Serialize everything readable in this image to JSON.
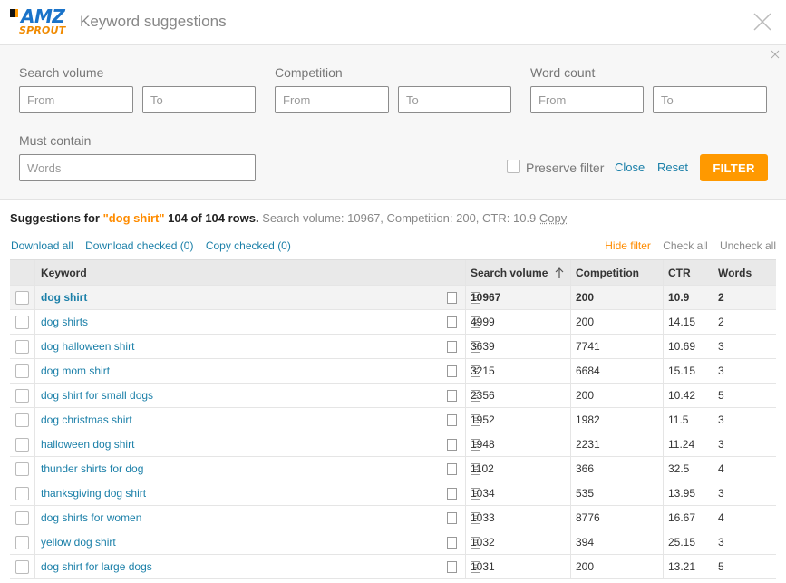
{
  "app": {
    "logo_top": "AMZ",
    "logo_bottom": "SPROUT",
    "title": "Keyword suggestions"
  },
  "icons": {
    "close": "close-icon",
    "copy": "copy-icon",
    "details": "document-icon",
    "sort": "sort-arrow-up-icon"
  },
  "colors": {
    "accent": "#ff9900",
    "link": "#1a7fa8",
    "brand_blue": "#1a73c9"
  },
  "filters": {
    "search_volume": {
      "label": "Search volume",
      "from_placeholder": "From",
      "to_placeholder": "To"
    },
    "competition": {
      "label": "Competition",
      "from_placeholder": "From",
      "to_placeholder": "To"
    },
    "word_count": {
      "label": "Word count",
      "from_placeholder": "From",
      "to_placeholder": "To"
    },
    "must_contain": {
      "label": "Must contain",
      "placeholder": "Words"
    },
    "preserve_label": "Preserve filter",
    "close_label": "Close",
    "reset_label": "Reset",
    "filter_label": "FILTER"
  },
  "summary": {
    "prefix": "Suggestions for",
    "keyword": "\"dog shirt\"",
    "rows": "104 of 104 rows.",
    "stats": "Search volume: 10967, Competition: 200, CTR: 10.9",
    "copy": "Copy"
  },
  "actions": {
    "download_all": "Download all",
    "download_checked": "Download checked (0)",
    "copy_checked": "Copy checked (0)",
    "hide_filter": "Hide filter",
    "check_all": "Check all",
    "uncheck_all": "Uncheck all"
  },
  "table": {
    "headers": {
      "keyword": "Keyword",
      "search_volume": "Search volume",
      "competition": "Competition",
      "ctr": "CTR",
      "words": "Words"
    },
    "rows": [
      {
        "keyword": "dog shirt",
        "sv": "10967",
        "comp": "200",
        "ctr": "10.9",
        "words": "2"
      },
      {
        "keyword": "dog shirts",
        "sv": "4999",
        "comp": "200",
        "ctr": "14.15",
        "words": "2"
      },
      {
        "keyword": "dog halloween shirt",
        "sv": "3639",
        "comp": "7741",
        "ctr": "10.69",
        "words": "3"
      },
      {
        "keyword": "dog mom shirt",
        "sv": "3215",
        "comp": "6684",
        "ctr": "15.15",
        "words": "3"
      },
      {
        "keyword": "dog shirt for small dogs",
        "sv": "2356",
        "comp": "200",
        "ctr": "10.42",
        "words": "5"
      },
      {
        "keyword": "dog christmas shirt",
        "sv": "1952",
        "comp": "1982",
        "ctr": "11.5",
        "words": "3"
      },
      {
        "keyword": "halloween dog shirt",
        "sv": "1948",
        "comp": "2231",
        "ctr": "11.24",
        "words": "3"
      },
      {
        "keyword": "thunder shirts for dog",
        "sv": "1102",
        "comp": "366",
        "ctr": "32.5",
        "words": "4"
      },
      {
        "keyword": "thanksgiving dog shirt",
        "sv": "1034",
        "comp": "535",
        "ctr": "13.95",
        "words": "3"
      },
      {
        "keyword": "dog shirts for women",
        "sv": "1033",
        "comp": "8776",
        "ctr": "16.67",
        "words": "4"
      },
      {
        "keyword": "yellow dog shirt",
        "sv": "1032",
        "comp": "394",
        "ctr": "25.15",
        "words": "3"
      },
      {
        "keyword": "dog shirt for large dogs",
        "sv": "1031",
        "comp": "200",
        "ctr": "13.21",
        "words": "5"
      }
    ]
  }
}
